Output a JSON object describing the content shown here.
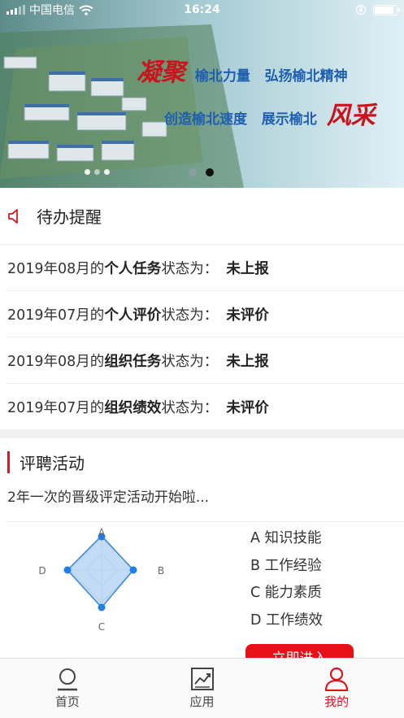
{
  "status_bar": {
    "carrier": "中国电信",
    "time": "16:24",
    "battery_level": 0.9
  },
  "banner": {
    "slogan_line1_big": "凝聚",
    "slogan_line1_a": "榆北力量",
    "slogan_line1_b": "弘扬榆北精神",
    "slogan_line2_a": "创造榆北速度",
    "slogan_line2_b": "展示榆北",
    "slogan_line2_big": "风采",
    "pager_count": 2,
    "pager_active": 1
  },
  "todo": {
    "title": "待办提醒",
    "icon": "speaker-icon",
    "items": [
      {
        "prefix": "2019年08月的",
        "name": "个人任务",
        "middle": "状态为：",
        "status": "未上报"
      },
      {
        "prefix": "2019年07月的",
        "name": "个人评价",
        "middle": "状态为：",
        "status": "未评价"
      },
      {
        "prefix": "2019年08月的",
        "name": "组织任务",
        "middle": "状态为：",
        "status": "未上报"
      },
      {
        "prefix": "2019年07月的",
        "name": "组织绩效",
        "middle": "状态为：",
        "status": "未评价"
      }
    ]
  },
  "evaluation": {
    "title": "评聘活动",
    "description": "2年一次的晋级评定活动开始啦...",
    "radar_axes": [
      "A",
      "B",
      "C",
      "D"
    ],
    "legend": [
      "A 知识技能",
      "B 工作经验",
      "C 能力素质",
      "D 工作绩效"
    ],
    "enter_button": "立即进入",
    "accent_color": "#e80f17"
  },
  "tabbar": {
    "tabs": [
      {
        "label": "首页",
        "icon": "home-icon",
        "active": false
      },
      {
        "label": "应用",
        "icon": "chart-icon",
        "active": false
      },
      {
        "label": "我的",
        "icon": "user-icon",
        "active": true
      }
    ],
    "active_color": "#e0121a"
  }
}
